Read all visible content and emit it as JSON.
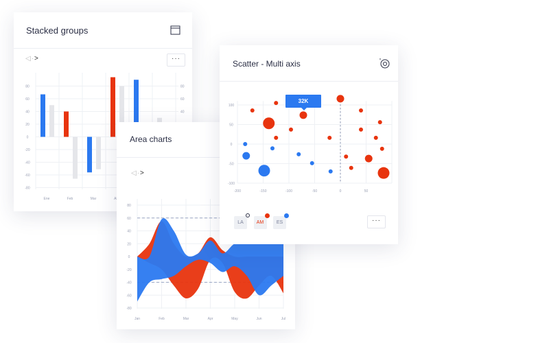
{
  "colors": {
    "blue": "#2b79f0",
    "red": "#e8340e",
    "gray": "#e5e6ea"
  },
  "stacked_card": {
    "title": "Stacked groups",
    "icon": "window-icon",
    "nav": {
      "prev": "◁",
      "sep": "·",
      "next": ">"
    },
    "more_label": "···"
  },
  "area_card": {
    "title": "Area charts",
    "nav": {
      "prev": "◁",
      "sep": "·",
      "next": ">"
    }
  },
  "scatter_card": {
    "title": "Scatter - Multi axis",
    "icon": "target-icon",
    "tooltip": "32K",
    "legend": [
      {
        "label": "LA",
        "color": "#2b2f45",
        "hollow": true
      },
      {
        "label": "AM",
        "color": "#e8340e",
        "hollow": false
      },
      {
        "label": "ES",
        "color": "#2b79f0",
        "hollow": false
      }
    ],
    "more_label": "···"
  },
  "chart_data": [
    {
      "type": "bar",
      "title": "Stacked groups",
      "categories": [
        "Ene",
        "Feb",
        "Mar",
        "Abr"
      ],
      "yticks": [
        80,
        60,
        40,
        20,
        0,
        -20,
        -40,
        -60,
        -80
      ],
      "right_yticks": [
        80,
        60,
        40
      ],
      "ylim": [
        -80,
        80
      ],
      "grid": true,
      "bars": [
        {
          "category_index": 0,
          "series": "blue",
          "value": 67
        },
        {
          "category_index": 0,
          "series": "gray",
          "value": 50
        },
        {
          "category_index": 1,
          "series": "red",
          "value": 40
        },
        {
          "category_index": 1,
          "series": "gray",
          "value": -66
        },
        {
          "category_index": 2,
          "series": "blue",
          "value": -56
        },
        {
          "category_index": 2,
          "series": "gray",
          "value": -51
        },
        {
          "category_index": 3,
          "series": "red",
          "value": 94
        },
        {
          "category_index": 3,
          "series": "gray",
          "value": 80
        },
        {
          "category_index": 4,
          "series": "blue",
          "value": 90
        },
        {
          "category_index": 5,
          "series": "gray",
          "value": 30
        }
      ]
    },
    {
      "type": "area",
      "title": "Area charts",
      "categories": [
        "Jan",
        "Feb",
        "Mar",
        "Apr",
        "May",
        "Jun",
        "Jul"
      ],
      "yticks": [
        80,
        60,
        40,
        20,
        0,
        -20,
        -40,
        -60,
        -80
      ],
      "ylim": [
        -80,
        80
      ],
      "reference_lines": [
        60,
        -40
      ],
      "grid": true,
      "x": [
        0,
        0.5,
        1,
        1.5,
        2,
        2.5,
        3,
        3.5,
        4,
        4.5,
        5,
        5.5,
        6
      ],
      "series": [
        {
          "color": "red",
          "upper": [
            0,
            20,
            55,
            20,
            0,
            5,
            30,
            10,
            0,
            0,
            0,
            0,
            0
          ],
          "lower": [
            0,
            -10,
            -20,
            -45,
            -65,
            -50,
            -5,
            -10,
            -55,
            -65,
            -45,
            -30,
            -57
          ]
        },
        {
          "color": "blue",
          "upper": [
            0,
            0,
            58,
            40,
            3,
            5,
            25,
            5,
            20,
            20,
            20,
            20,
            20
          ],
          "lower": [
            -70,
            -40,
            -35,
            -30,
            -15,
            -5,
            -10,
            -24,
            -15,
            -30,
            -60,
            -45,
            -30
          ]
        }
      ]
    },
    {
      "type": "scatter",
      "title": "Scatter - Multi axis",
      "xticks": [
        -200,
        -150,
        -100,
        -50,
        0,
        50
      ],
      "yticks": [
        100,
        50,
        0,
        -50,
        -100
      ],
      "xlim": [
        -200,
        100
      ],
      "ylim": [
        -100,
        110
      ],
      "grid": true,
      "series": [
        {
          "color": "red",
          "points": [
            [
              -171,
              86,
              1
            ],
            [
              -125,
              105,
              1
            ],
            [
              -139,
              53,
              3
            ],
            [
              -72,
              74,
              2
            ],
            [
              -96,
              37,
              1
            ],
            [
              -125,
              16,
              1
            ],
            [
              -21,
              16,
              1
            ],
            [
              0,
              116,
              2
            ],
            [
              40,
              86,
              1
            ],
            [
              40,
              37,
              1
            ],
            [
              77,
              56,
              1
            ],
            [
              69,
              16,
              1
            ],
            [
              81,
              -12,
              1
            ],
            [
              11,
              -32,
              1
            ],
            [
              55,
              -37,
              2
            ],
            [
              21,
              -61,
              1
            ],
            [
              84,
              -74,
              3
            ]
          ]
        },
        {
          "color": "blue",
          "points": [
            [
              -185,
              0,
              1
            ],
            [
              -183,
              -30,
              2
            ],
            [
              -132,
              -11,
              1
            ],
            [
              -81,
              -26,
              1
            ],
            [
              -55,
              -49,
              1
            ],
            [
              -148,
              -68,
              3
            ],
            [
              -19,
              -70,
              1
            ]
          ]
        }
      ]
    }
  ]
}
